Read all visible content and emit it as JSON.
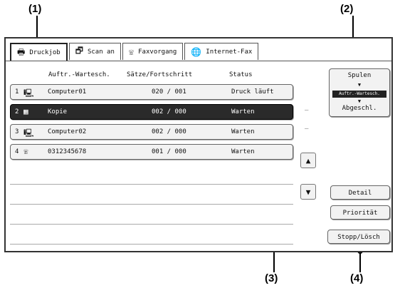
{
  "callouts": [
    "(1)",
    "(2)",
    "(3)",
    "(4)"
  ],
  "tabs": [
    {
      "label": "Druckjob",
      "icon": "printer-icon",
      "glyph": "🖶"
    },
    {
      "label": "Scan an",
      "icon": "scan-icon",
      "glyph": "🗗"
    },
    {
      "label": "Faxvorgang",
      "icon": "fax-icon",
      "glyph": "☏"
    },
    {
      "label": "Internet-Fax",
      "icon": "internet-fax-icon",
      "glyph": "🌐"
    }
  ],
  "columns": {
    "queue": "Auftr.-Wartesch.",
    "progress": "Sätze/Fortschritt",
    "status": "Status"
  },
  "jobs": [
    {
      "num": "1",
      "icon": "computer-icon",
      "glyph": "🖳",
      "name": "Computer01",
      "progress": "020 / 001",
      "status": "Druck läuft"
    },
    {
      "num": "2",
      "icon": "copy-icon",
      "glyph": "▦",
      "name": "Kopie",
      "progress": "002 / 000",
      "status": "Warten"
    },
    {
      "num": "3",
      "icon": "computer-icon",
      "glyph": "🖳",
      "name": "Computer02",
      "progress": "002 / 000",
      "status": "Warten"
    },
    {
      "num": "4",
      "icon": "fax-icon",
      "glyph": "☏",
      "name": "0312345678",
      "progress": "001 / 000",
      "status": "Warten"
    }
  ],
  "selected_index": 1,
  "spool": {
    "top": "Spulen",
    "middle": "Auftr.-Wartesch.",
    "bottom": "Abgeschl."
  },
  "scroll_up": "▲",
  "scroll_down": "▼",
  "buttons": {
    "detail": "Detail",
    "priority": "Priorität",
    "stop": "Stopp/Lösch"
  }
}
